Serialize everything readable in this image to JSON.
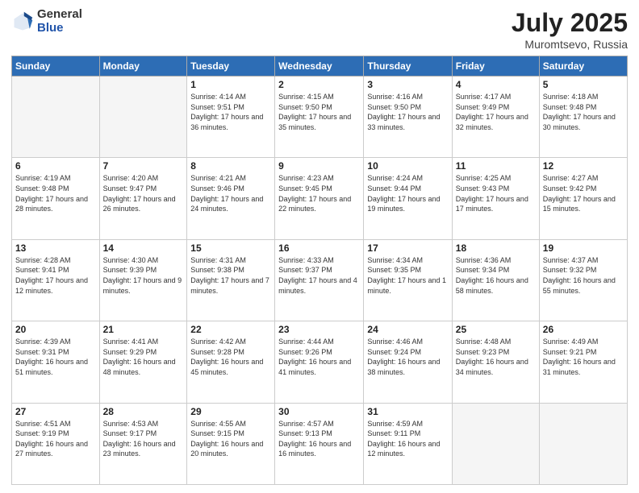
{
  "logo": {
    "general": "General",
    "blue": "Blue"
  },
  "title": "July 2025",
  "subtitle": "Muromtsevo, Russia",
  "weekdays": [
    "Sunday",
    "Monday",
    "Tuesday",
    "Wednesday",
    "Thursday",
    "Friday",
    "Saturday"
  ],
  "weeks": [
    [
      {
        "day": "",
        "info": ""
      },
      {
        "day": "",
        "info": ""
      },
      {
        "day": "1",
        "info": "Sunrise: 4:14 AM\nSunset: 9:51 PM\nDaylight: 17 hours and 36 minutes."
      },
      {
        "day": "2",
        "info": "Sunrise: 4:15 AM\nSunset: 9:50 PM\nDaylight: 17 hours and 35 minutes."
      },
      {
        "day": "3",
        "info": "Sunrise: 4:16 AM\nSunset: 9:50 PM\nDaylight: 17 hours and 33 minutes."
      },
      {
        "day": "4",
        "info": "Sunrise: 4:17 AM\nSunset: 9:49 PM\nDaylight: 17 hours and 32 minutes."
      },
      {
        "day": "5",
        "info": "Sunrise: 4:18 AM\nSunset: 9:48 PM\nDaylight: 17 hours and 30 minutes."
      }
    ],
    [
      {
        "day": "6",
        "info": "Sunrise: 4:19 AM\nSunset: 9:48 PM\nDaylight: 17 hours and 28 minutes."
      },
      {
        "day": "7",
        "info": "Sunrise: 4:20 AM\nSunset: 9:47 PM\nDaylight: 17 hours and 26 minutes."
      },
      {
        "day": "8",
        "info": "Sunrise: 4:21 AM\nSunset: 9:46 PM\nDaylight: 17 hours and 24 minutes."
      },
      {
        "day": "9",
        "info": "Sunrise: 4:23 AM\nSunset: 9:45 PM\nDaylight: 17 hours and 22 minutes."
      },
      {
        "day": "10",
        "info": "Sunrise: 4:24 AM\nSunset: 9:44 PM\nDaylight: 17 hours and 19 minutes."
      },
      {
        "day": "11",
        "info": "Sunrise: 4:25 AM\nSunset: 9:43 PM\nDaylight: 17 hours and 17 minutes."
      },
      {
        "day": "12",
        "info": "Sunrise: 4:27 AM\nSunset: 9:42 PM\nDaylight: 17 hours and 15 minutes."
      }
    ],
    [
      {
        "day": "13",
        "info": "Sunrise: 4:28 AM\nSunset: 9:41 PM\nDaylight: 17 hours and 12 minutes."
      },
      {
        "day": "14",
        "info": "Sunrise: 4:30 AM\nSunset: 9:39 PM\nDaylight: 17 hours and 9 minutes."
      },
      {
        "day": "15",
        "info": "Sunrise: 4:31 AM\nSunset: 9:38 PM\nDaylight: 17 hours and 7 minutes."
      },
      {
        "day": "16",
        "info": "Sunrise: 4:33 AM\nSunset: 9:37 PM\nDaylight: 17 hours and 4 minutes."
      },
      {
        "day": "17",
        "info": "Sunrise: 4:34 AM\nSunset: 9:35 PM\nDaylight: 17 hours and 1 minute."
      },
      {
        "day": "18",
        "info": "Sunrise: 4:36 AM\nSunset: 9:34 PM\nDaylight: 16 hours and 58 minutes."
      },
      {
        "day": "19",
        "info": "Sunrise: 4:37 AM\nSunset: 9:32 PM\nDaylight: 16 hours and 55 minutes."
      }
    ],
    [
      {
        "day": "20",
        "info": "Sunrise: 4:39 AM\nSunset: 9:31 PM\nDaylight: 16 hours and 51 minutes."
      },
      {
        "day": "21",
        "info": "Sunrise: 4:41 AM\nSunset: 9:29 PM\nDaylight: 16 hours and 48 minutes."
      },
      {
        "day": "22",
        "info": "Sunrise: 4:42 AM\nSunset: 9:28 PM\nDaylight: 16 hours and 45 minutes."
      },
      {
        "day": "23",
        "info": "Sunrise: 4:44 AM\nSunset: 9:26 PM\nDaylight: 16 hours and 41 minutes."
      },
      {
        "day": "24",
        "info": "Sunrise: 4:46 AM\nSunset: 9:24 PM\nDaylight: 16 hours and 38 minutes."
      },
      {
        "day": "25",
        "info": "Sunrise: 4:48 AM\nSunset: 9:23 PM\nDaylight: 16 hours and 34 minutes."
      },
      {
        "day": "26",
        "info": "Sunrise: 4:49 AM\nSunset: 9:21 PM\nDaylight: 16 hours and 31 minutes."
      }
    ],
    [
      {
        "day": "27",
        "info": "Sunrise: 4:51 AM\nSunset: 9:19 PM\nDaylight: 16 hours and 27 minutes."
      },
      {
        "day": "28",
        "info": "Sunrise: 4:53 AM\nSunset: 9:17 PM\nDaylight: 16 hours and 23 minutes."
      },
      {
        "day": "29",
        "info": "Sunrise: 4:55 AM\nSunset: 9:15 PM\nDaylight: 16 hours and 20 minutes."
      },
      {
        "day": "30",
        "info": "Sunrise: 4:57 AM\nSunset: 9:13 PM\nDaylight: 16 hours and 16 minutes."
      },
      {
        "day": "31",
        "info": "Sunrise: 4:59 AM\nSunset: 9:11 PM\nDaylight: 16 hours and 12 minutes."
      },
      {
        "day": "",
        "info": ""
      },
      {
        "day": "",
        "info": ""
      }
    ]
  ]
}
